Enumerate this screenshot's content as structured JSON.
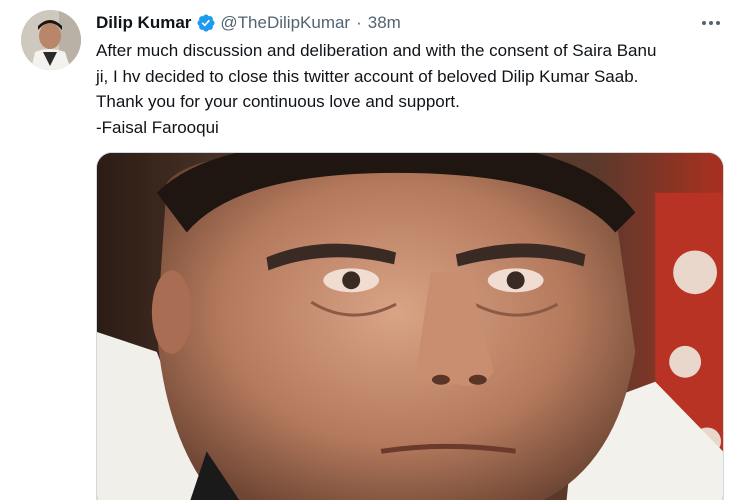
{
  "tweet": {
    "author_name": "Dilip Kumar",
    "handle": "@TheDilipKumar",
    "separator": "·",
    "time": "38m",
    "text_lines": [
      "After much discussion and deliberation and with the consent of Saira Banu",
      "ji, I hv decided to close this twitter account of beloved Dilip Kumar Saab.",
      "Thank you for your continuous love and support.",
      "-Faisal Farooqui"
    ],
    "verified_icon": "verified-badge-icon",
    "more_icon": "more-horizontal-icon"
  },
  "colors": {
    "verified_blue": "#1d9bf0",
    "text_primary": "#0f1419",
    "text_secondary": "#536471"
  }
}
